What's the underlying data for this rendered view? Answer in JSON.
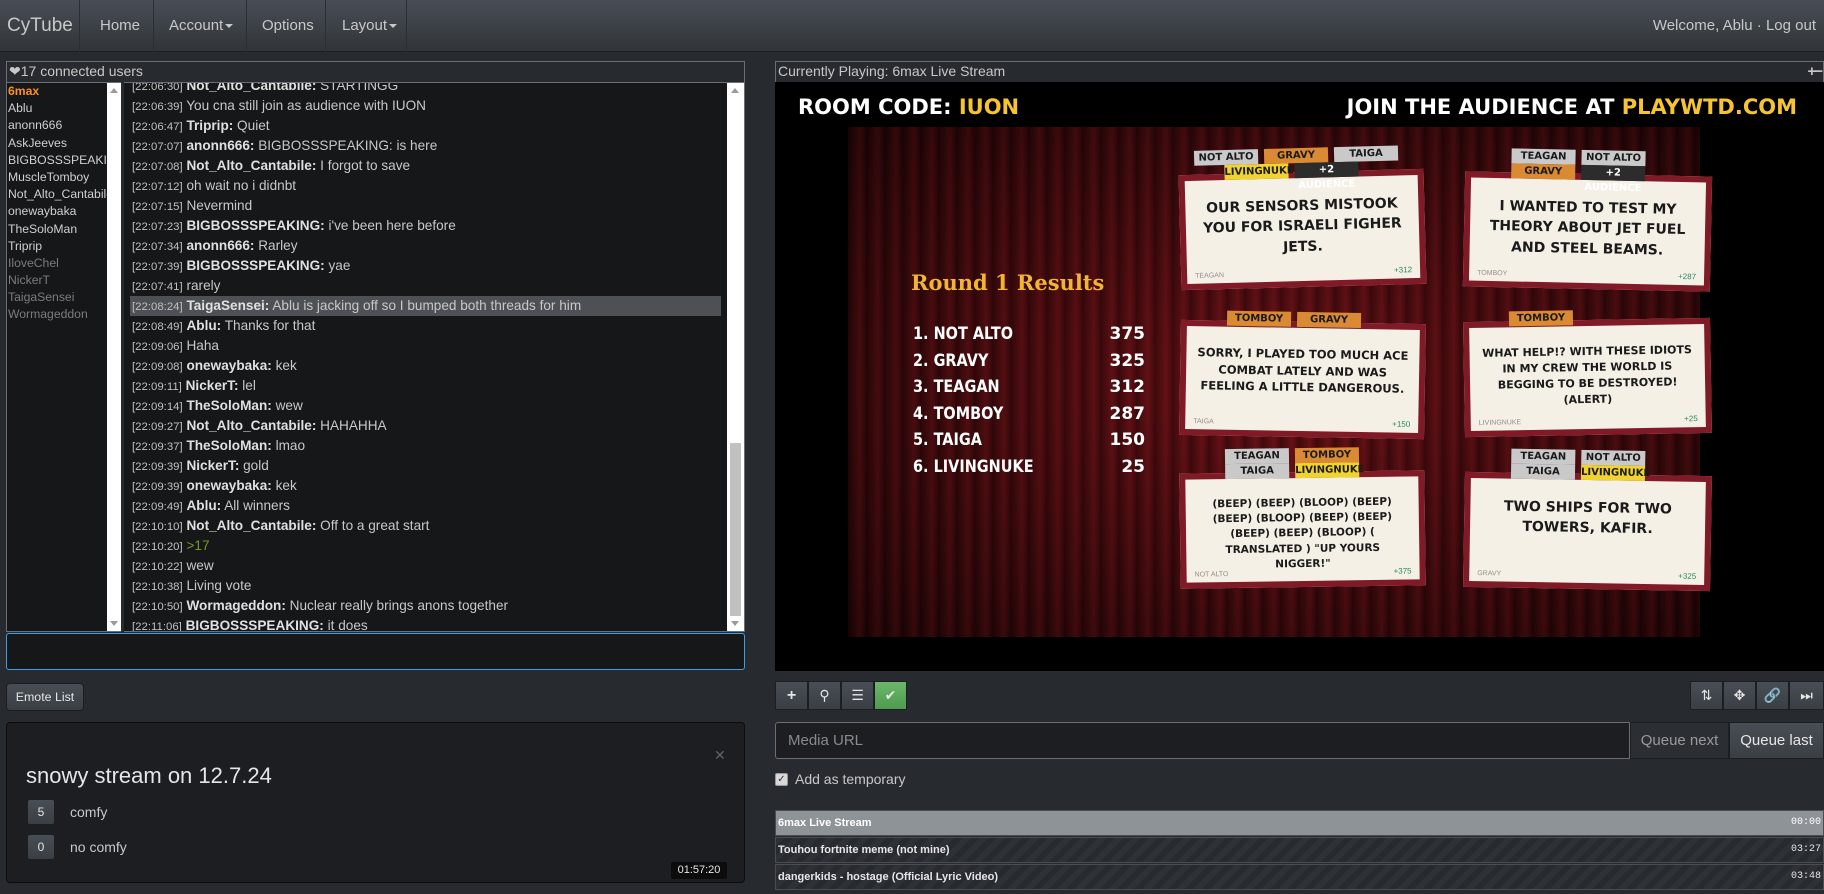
{
  "navbar": {
    "brand": "CyTube",
    "home": "Home",
    "account": "Account",
    "options": "Options",
    "layout": "Layout",
    "welcome": "Welcome, Ablu",
    "separator": "·",
    "logout": "Log out"
  },
  "userlist": {
    "header": "17 connected users",
    "users": [
      {
        "name": "6max",
        "state": "leader"
      },
      {
        "name": "Ablu",
        "state": "normal"
      },
      {
        "name": "anonn666",
        "state": "normal"
      },
      {
        "name": "AskJeeves",
        "state": "normal"
      },
      {
        "name": "BIGBOSSSPEAKING",
        "state": "normal"
      },
      {
        "name": "MuscleTomboy",
        "state": "normal"
      },
      {
        "name": "Not_Alto_Cantabile",
        "state": "normal"
      },
      {
        "name": "onewaybaka",
        "state": "normal"
      },
      {
        "name": "TheSoloMan",
        "state": "normal"
      },
      {
        "name": "Triprip",
        "state": "normal"
      },
      {
        "name": "IloveChel",
        "state": "afk"
      },
      {
        "name": "NickerT",
        "state": "afk"
      },
      {
        "name": "TaigaSensei",
        "state": "afk"
      },
      {
        "name": "Wormageddon",
        "state": "afk"
      }
    ]
  },
  "chat": {
    "messages": [
      {
        "ts": "[22:06:30]",
        "user": "Not_Alto_Cantabile:",
        "text": " STARTINGG"
      },
      {
        "ts": "[22:06:39]",
        "user": "",
        "text": " You cna still join as audience with IUON"
      },
      {
        "ts": "[22:06:47]",
        "user": "Triprip:",
        "text": " Quiet"
      },
      {
        "ts": "[22:07:07]",
        "user": "anonn666:",
        "text": " BIGBOSSSPEAKING:  is here"
      },
      {
        "ts": "[22:07:08]",
        "user": "Not_Alto_Cantabile:",
        "text": " I forgot to save"
      },
      {
        "ts": "[22:07:12]",
        "user": "",
        "text": " oh wait no i didnbt"
      },
      {
        "ts": "[22:07:15]",
        "user": "",
        "text": " Nevermind"
      },
      {
        "ts": "[22:07:23]",
        "user": "BIGBOSSSPEAKING:",
        "text": " i've been here before"
      },
      {
        "ts": "[22:07:34]",
        "user": "anonn666:",
        "text": " Rarley"
      },
      {
        "ts": "[22:07:39]",
        "user": "BIGBOSSSPEAKING:",
        "text": " yae"
      },
      {
        "ts": "[22:07:41]",
        "user": "",
        "text": " rarely"
      },
      {
        "ts": "[22:08:24]",
        "user": "TaigaSensei:",
        "text": " Ablu is jacking off so I bumped both threads for him",
        "highlight": true
      },
      {
        "ts": "[22:08:49]",
        "user": "Ablu:",
        "text": " Thanks for that"
      },
      {
        "ts": "[22:09:06]",
        "user": "",
        "text": " Haha"
      },
      {
        "ts": "[22:09:08]",
        "user": "onewaybaka:",
        "text": " kek"
      },
      {
        "ts": "[22:09:11]",
        "user": "NickerT:",
        "text": " lel"
      },
      {
        "ts": "[22:09:14]",
        "user": "TheSoloMan:",
        "text": " wew"
      },
      {
        "ts": "[22:09:27]",
        "user": "Not_Alto_Cantabile:",
        "text": " HAHAHHA"
      },
      {
        "ts": "[22:09:37]",
        "user": "TheSoloMan:",
        "text": " lmao"
      },
      {
        "ts": "[22:09:39]",
        "user": "NickerT:",
        "text": " gold"
      },
      {
        "ts": "[22:09:39]",
        "user": "onewaybaka:",
        "text": " kek"
      },
      {
        "ts": "[22:09:49]",
        "user": "Ablu:",
        "text": " All winners"
      },
      {
        "ts": "[22:10:10]",
        "user": "Not_Alto_Cantabile:",
        "text": " Off to a great start"
      },
      {
        "ts": "[22:10:20]",
        "user": "",
        "text": " >17",
        "greentext": true
      },
      {
        "ts": "[22:10:22]",
        "user": "",
        "text": " wew"
      },
      {
        "ts": "[22:10:38]",
        "user": "",
        "text": " Living vote"
      },
      {
        "ts": "[22:10:50]",
        "user": "Wormageddon:",
        "text": " Nuclear really brings anons together"
      },
      {
        "ts": "[22:11:06]",
        "user": "BIGBOSSSPEAKING:",
        "text": " it does"
      }
    ],
    "input_value": "",
    "emote_button": "Emote List"
  },
  "poll": {
    "title": "snowy stream on 12.7.24",
    "options": [
      {
        "count": "5",
        "label": "comfy"
      },
      {
        "count": "0",
        "label": "no comfy"
      }
    ],
    "timer": "01:57:20"
  },
  "video": {
    "header": "Currently Playing: 6max Live Stream",
    "size_controls": "+−",
    "room_code_label": "ROOM CODE: ",
    "room_code": "IUON",
    "join_label": "JOIN THE AUDIENCE AT ",
    "join_site": "PLAYWTD.COM",
    "round_title": "Round 1 Results",
    "scores": [
      {
        "name": "1. NOT ALTO",
        "score": "375"
      },
      {
        "name": "2. GRAVY",
        "score": "325"
      },
      {
        "name": "3. TEAGAN",
        "score": "312"
      },
      {
        "name": "4. TOMBOY",
        "score": "287"
      },
      {
        "name": "5. TAIGA",
        "score": "150"
      },
      {
        "name": "6. LIVINGNUKE",
        "score": "25"
      }
    ],
    "cards": [
      {
        "tags": [
          "NOT ALTO",
          "GRAVY",
          "TAIGA",
          "LIVINGNUKE",
          "+2 AUDIENCE"
        ],
        "text": "OUR SENSORS MISTOOK YOU FOR ISRAELI FIGHER JETS.",
        "author": "TEAGAN",
        "score": "+312"
      },
      {
        "tags": [
          "TEAGAN",
          "NOT ALTO",
          "GRAVY",
          "+2 AUDIENCE"
        ],
        "text": "I WANTED TO TEST MY THEORY ABOUT JET FUEL AND STEEL BEAMS.",
        "author": "TOMBOY",
        "score": "+287"
      },
      {
        "tags": [
          "TOMBOY",
          "GRAVY"
        ],
        "text": "SORRY, I PLAYED TOO MUCH ACE COMBAT LATELY AND WAS FEELING A LITTLE DANGEROUS.",
        "author": "TAIGA",
        "score": "+150"
      },
      {
        "tags": [
          "TOMBOY"
        ],
        "text": "WHAT HELP!? WITH THESE IDIOTS IN MY CREW THE WORLD IS BEGGING TO BE DESTROYED! (ALERT)",
        "author": "LIVINGNUKE",
        "score": "+25"
      },
      {
        "tags": [
          "TEAGAN",
          "TOMBOY",
          "TAIGA",
          "LIVINGNUKE"
        ],
        "text": "(BEEP) (BEEP) (BLOOP) (BEEP) (BEEP) (BLOOP) (BEEP) (BEEP) (BEEP) (BEEP) (BLOOP) ( TRANSLATED ) \"UP YOURS NIGGER!\"",
        "author": "NOT ALTO",
        "score": "+375"
      },
      {
        "tags": [
          "TEAGAN",
          "NOT ALTO",
          "TAIGA",
          "LIVINGNUKE"
        ],
        "text": "TWO SHIPS FOR TWO TOWERS, KAFIR.",
        "author": "GRAVY",
        "score": "+325"
      }
    ]
  },
  "controls": {
    "add_icon": "plus-icon",
    "search_icon": "search-icon",
    "list_icon": "list-icon",
    "check_icon": "check-icon",
    "reload_icon": "reload-icon",
    "fullscreen_icon": "fullscreen-icon",
    "link_icon": "link-icon",
    "skip_icon": "skip-icon"
  },
  "addmedia": {
    "placeholder": "Media URL",
    "queue_next": "Queue next",
    "queue_last": "Queue last",
    "temporary_label": "Add as temporary",
    "temporary_checked": true
  },
  "queue": [
    {
      "title": "6max Live Stream",
      "time": "00:00",
      "active": true
    },
    {
      "title": "Touhou fortnite meme (not mine)",
      "time": "03:27",
      "active": false
    },
    {
      "title": "dangerkids - hostage (Official Lyric Video)",
      "time": "03:48",
      "active": false
    }
  ]
}
